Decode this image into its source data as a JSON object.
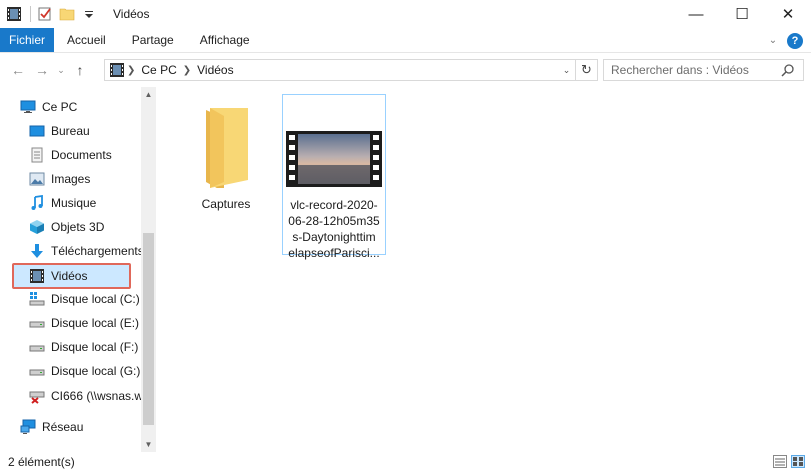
{
  "window": {
    "title": "Vidéos"
  },
  "controls": {
    "minimize": "—",
    "maximize": "☐",
    "close": "✕"
  },
  "ribbon": {
    "tabs": [
      {
        "label": "Fichier"
      },
      {
        "label": "Accueil"
      },
      {
        "label": "Partage"
      },
      {
        "label": "Affichage"
      }
    ],
    "help": "?"
  },
  "address": {
    "crumbs": [
      "Ce PC",
      "Vidéos"
    ]
  },
  "search": {
    "placeholder": "Rechercher dans : Vidéos"
  },
  "sidebar": {
    "items": [
      {
        "label": "Ce PC",
        "icon": "pc-icon"
      },
      {
        "label": "Bureau",
        "icon": "desktop-icon"
      },
      {
        "label": "Documents",
        "icon": "documents-icon"
      },
      {
        "label": "Images",
        "icon": "images-icon"
      },
      {
        "label": "Musique",
        "icon": "music-icon"
      },
      {
        "label": "Objets 3D",
        "icon": "objects3d-icon"
      },
      {
        "label": "Téléchargements",
        "icon": "download-icon"
      },
      {
        "label": "Vidéos",
        "icon": "videos-icon",
        "selected": true
      },
      {
        "label": "Disque local (C:)",
        "icon": "system-drive-icon"
      },
      {
        "label": "Disque local (E:)",
        "icon": "drive-icon"
      },
      {
        "label": "Disque local (F:)",
        "icon": "drive-icon"
      },
      {
        "label": "Disque local (G:)",
        "icon": "drive-icon"
      },
      {
        "label": "CI666 (\\\\wsnas.w",
        "icon": "network-drive-disconnected-icon"
      },
      {
        "label": "Réseau",
        "icon": "network-icon"
      }
    ]
  },
  "files": [
    {
      "name": "Captures",
      "type": "folder",
      "icon": "folder-icon"
    },
    {
      "name_lines": [
        "vlc-record-2020-",
        "06-28-12h05m35",
        "s-Daytonighttim",
        "elapseofParisci..."
      ],
      "type": "video",
      "icon": "video-thumbnail-icon",
      "selected": true
    }
  ],
  "status": {
    "count": "2 élément(s)"
  },
  "colors": {
    "accent": "#1979ca",
    "selection": "#cce8ff",
    "highlight_border": "#e0685a",
    "folder": "#f8d775"
  }
}
